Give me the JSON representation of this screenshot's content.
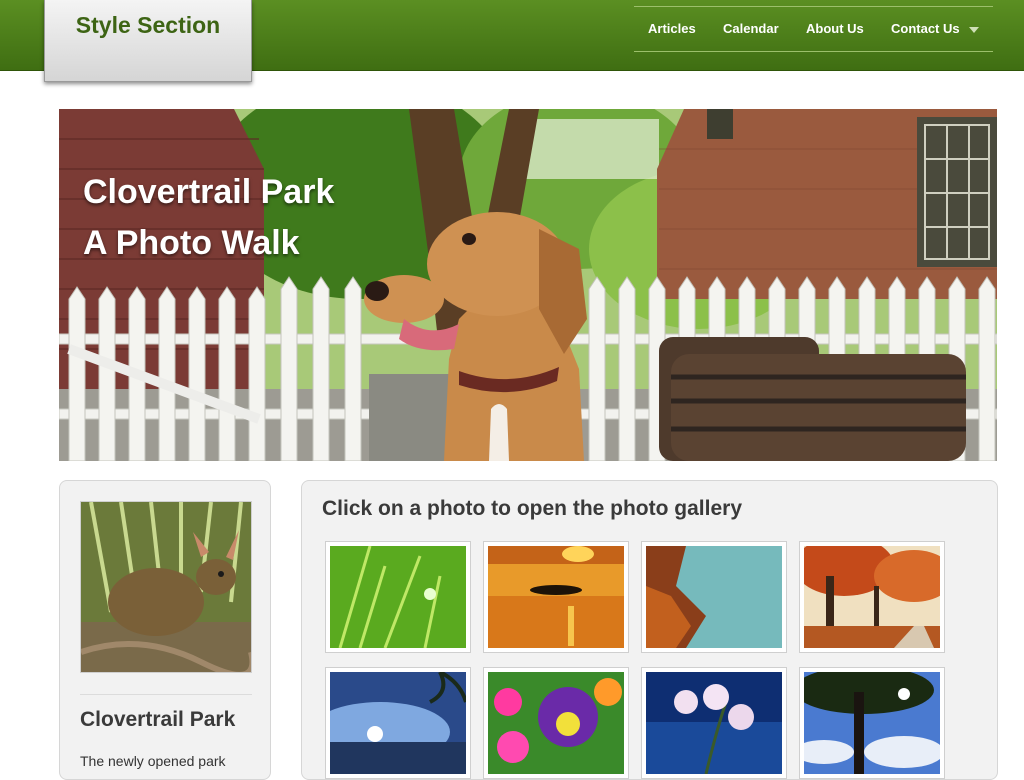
{
  "site": {
    "logo_text": "Style Section"
  },
  "nav": {
    "items": [
      {
        "label": "Articles"
      },
      {
        "label": "Calendar"
      },
      {
        "label": "About Us"
      },
      {
        "label": "Contact Us"
      }
    ],
    "text_color": "#ffffff",
    "bar_color": "#4a7b18"
  },
  "hero": {
    "title_line1": "Clovertrail Park",
    "title_line2": "A Photo Walk"
  },
  "sidebar": {
    "title": "Clovertrail Park",
    "intro_text": "The newly opened park"
  },
  "gallery": {
    "heading": "Click on a photo to open the photo gallery",
    "photos": [
      {
        "icon": "grass-photo"
      },
      {
        "icon": "sunset-lake-photo"
      },
      {
        "icon": "rocky-coast-photo"
      },
      {
        "icon": "autumn-park-photo"
      },
      {
        "icon": "tropical-sunset-photo"
      },
      {
        "icon": "pansy-flowers-photo"
      },
      {
        "icon": "orchid-photo"
      },
      {
        "icon": "tree-sky-photo"
      }
    ]
  }
}
